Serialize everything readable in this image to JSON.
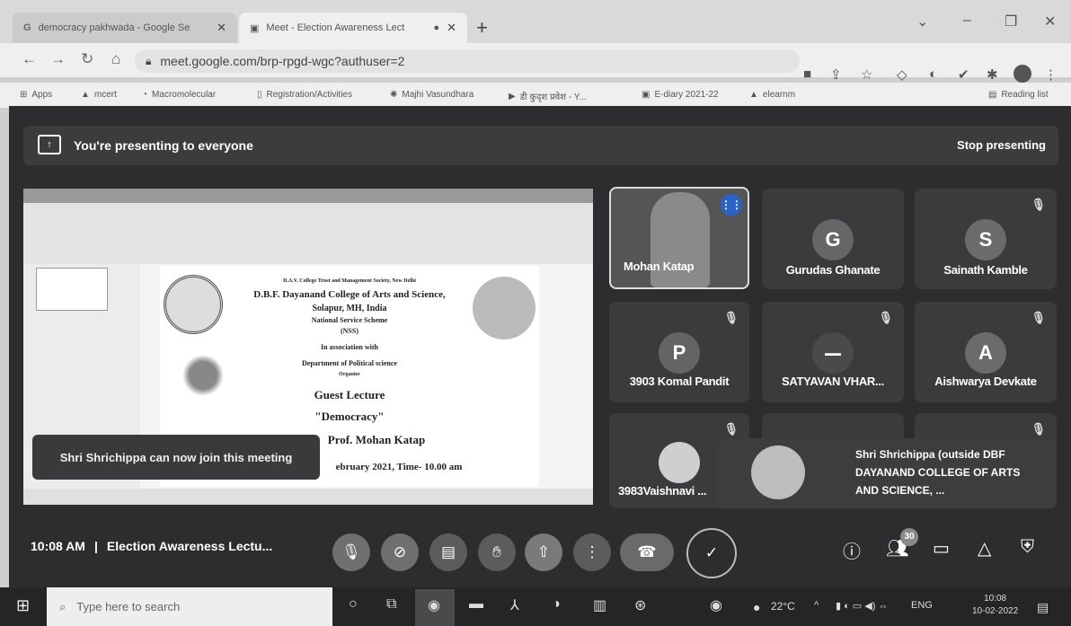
{
  "browser": {
    "tabs": [
      {
        "label": "democracy pakhwada - Google Se"
      },
      {
        "label": "Meet - Election Awareness Lect"
      }
    ],
    "url": "meet.google.com/brp-rpgd-wgc?authuser=2",
    "bookmarks": [
      "Apps",
      "mcert",
      "Macromolecular",
      "Registration/Activities",
      "Majhi Vasundhara",
      "डी कुदृश प्रवेश - Y...",
      "E-diary 2021-22",
      "elearnm",
      "Reading list"
    ]
  },
  "meet": {
    "banner_text": "You're presenting to everyone",
    "stop_label": "Stop presenting",
    "toast": "Shri Shrichippa can now join this meeting",
    "time": "10:08 AM",
    "separator": "|",
    "meeting_title": "Election Awareness Lectu...",
    "participant_count": "30",
    "participants": [
      {
        "name": "Mohan Katap",
        "initial": ""
      },
      {
        "name": "Gurudas Ghanate",
        "initial": "G"
      },
      {
        "name": "Sainath Kamble",
        "initial": "S"
      },
      {
        "name": "3903 Komal Pandit",
        "initial": "P"
      },
      {
        "name": "SATYAVAN VHAR...",
        "initial": ""
      },
      {
        "name": "Aishwarya Devkate",
        "initial": "A"
      },
      {
        "name": "3983Vaishnavi ...",
        "initial": ""
      },
      {
        "name": "Shri Shrichippa (outside DBF DAYANAND COLLEGE OF ARTS AND SCIENCE, ...",
        "initial": ""
      }
    ]
  },
  "slide": {
    "line1": "D.A.V. College Trust and Management Society, New Delhi",
    "line2": "D.B.F. Dayanand College of Arts and Science,",
    "line3": "Solapur, MH, India",
    "line4": "National Service Scheme",
    "line5": "(NSS)",
    "line6": "In association with",
    "line7": "Department of Political science",
    "line8": "Organize",
    "line9": "Guest Lecture",
    "line10": "\"Democracy\"",
    "line11": "Prof. Mohan Katap",
    "line12": "ebruary 2021, Time- 10.00 am"
  },
  "taskbar": {
    "search_placeholder": "Type here to search",
    "weather": "22°C",
    "lang": "ENG",
    "clock_time": "10:08",
    "clock_date": "10-02-2022"
  }
}
